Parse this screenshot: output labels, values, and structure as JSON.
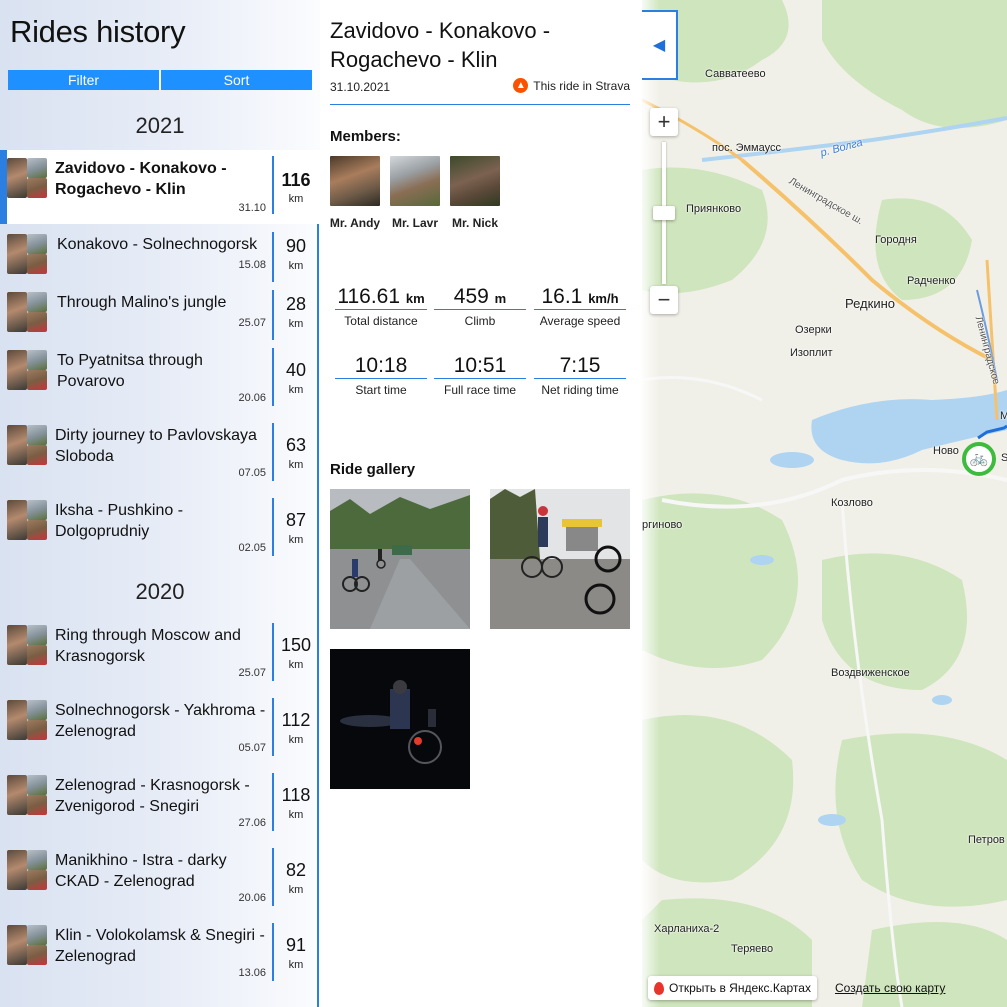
{
  "sidebar": {
    "title": "Rides history",
    "tabs": [
      "Filter",
      "Sort"
    ],
    "years": [
      "2021",
      "2020"
    ],
    "rides": [
      {
        "name": "Zavidovo - Konakovo - Rogachevo - Klin",
        "date": "31.10",
        "km": "116",
        "unit": "km",
        "active": true
      },
      {
        "name": "Konakovo - Solnechnogorsk",
        "date": "15.08",
        "km": "90",
        "unit": "km"
      },
      {
        "name": "Through Malino's jungle",
        "date": "25.07",
        "km": "28",
        "unit": "km"
      },
      {
        "name": "To Pyatnitsa through Povarovo",
        "date": "20.06",
        "km": "40",
        "unit": "km"
      },
      {
        "name": "Dirty journey to Pavlovskaya Sloboda",
        "date": "07.05",
        "km": "63",
        "unit": "km"
      },
      {
        "name": "Iksha - Pushkino - Dolgoprudniy",
        "date": "02.05",
        "km": "87",
        "unit": "km"
      },
      {
        "name": "Ring through Moscow and Krasnogorsk",
        "date": "25.07",
        "km": "150",
        "unit": "km"
      },
      {
        "name": "Solnechnogorsk - Yakhroma - Zelenograd",
        "date": "05.07",
        "km": "112",
        "unit": "km"
      },
      {
        "name": "Zelenograd - Krasnogorsk - Zvenigorod - Snegiri",
        "date": "27.06",
        "km": "118",
        "unit": "km"
      },
      {
        "name": "Manikhino - Istra - darky CKAD - Zelenograd",
        "date": "20.06",
        "km": "82",
        "unit": "km"
      },
      {
        "name": "Klin - Volokolamsk & Snegiri - Zelenograd",
        "date": "13.06",
        "km": "91",
        "unit": "km"
      }
    ]
  },
  "detail": {
    "title": "Zavidovo - Konakovo - Rogachevo - Klin",
    "date": "31.10.2021",
    "strava_label": "This ride in Strava",
    "members_heading": "Members:",
    "members": [
      "Mr. Andy",
      "Mr. Lavr",
      "Mr. Nick"
    ],
    "stats": [
      {
        "value": "116.61",
        "unit": "km",
        "label": "Total distance"
      },
      {
        "value": "459",
        "unit": "m",
        "label": "Climb"
      },
      {
        "value": "16.1",
        "unit": "km/h",
        "label": "Average speed"
      },
      {
        "value": "10:18",
        "unit": "",
        "label": "Start time"
      },
      {
        "value": "10:51",
        "unit": "",
        "label": "Full race time"
      },
      {
        "value": "7:15",
        "unit": "",
        "label": "Net riding time"
      }
    ],
    "gallery_heading": "Ride gallery"
  },
  "map": {
    "collapse_icon": "chevron-left-icon",
    "zoom_in": "+",
    "zoom_out": "−",
    "labels": {
      "savvateevo": "Савватеево",
      "emmaus": "пос. Эммаусс",
      "volga": "р. Волга",
      "leningradskoe": "Ленинградское ш.",
      "leningradskoe2": "Ленинградское",
      "priyanovo": "Приянково",
      "gorodnya": "Городня",
      "radchenko": "Радченко",
      "redkino": "Редкино",
      "ozerki": "Озерки",
      "izoplit": "Изоплит",
      "novo": "Ново",
      "kozlovo": "Козлово",
      "rginovo": "ргиново",
      "vozdvizhenskoe": "Воздвиженское",
      "petrov": "Петров",
      "kharlanikha": "Харланиха-2",
      "teryaevo": "Теряево",
      "m": "М",
      "s": "S"
    },
    "open_yandex": "Открыть в Яндекс.Картах",
    "create_map": "Создать свою карту",
    "colors": {
      "water": "#aed4f2",
      "forest": "#cfe5bd",
      "road": "#f5c26b",
      "route": "#1e6fd9"
    }
  }
}
